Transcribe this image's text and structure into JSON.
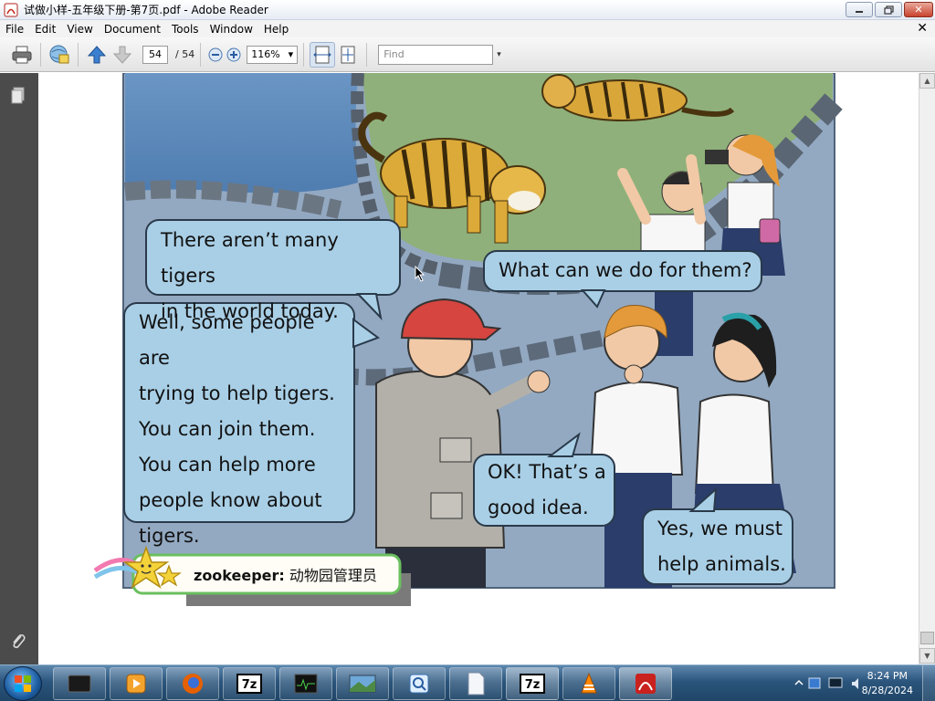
{
  "window": {
    "title": "试做小样-五年级下册-第7页.pdf - Adobe Reader",
    "minimize": "▭",
    "maximize": "❐",
    "close": "✕"
  },
  "menu": {
    "items": [
      "File",
      "Edit",
      "View",
      "Document",
      "Tools",
      "Window",
      "Help"
    ],
    "doc_close": "✕"
  },
  "toolbar": {
    "page_current": "54",
    "page_total": "/  54",
    "zoom": "116%",
    "zoom_arrow": "▾",
    "find_placeholder": "Find",
    "find_arrow": "▾"
  },
  "page": {
    "bubbles": {
      "tigers_line1": "There aren’t many tigers",
      "tigers_line2": "in the world today.",
      "what_do": "What can we do for them?",
      "well_lines": [
        "Well, some people are",
        "trying to help tigers.",
        "You can join them.",
        "You can help more",
        "people know about",
        "tigers."
      ],
      "ok_line1": "OK! That’s a",
      "ok_line2": "good idea.",
      "yes_line1": "Yes, we must",
      "yes_line2": "help animals."
    },
    "vocab": {
      "word": "zookeeper:",
      "meaning": "动物园管理员"
    }
  },
  "taskbar": {
    "time": "8:24 PM",
    "date": "8/28/2024"
  },
  "colors": {
    "bubble_fill": "#a9cfe6",
    "bubble_stroke": "#2a3a4a",
    "nav_pane": "#4b4b4b",
    "vocab_border": "#6abf5e"
  }
}
